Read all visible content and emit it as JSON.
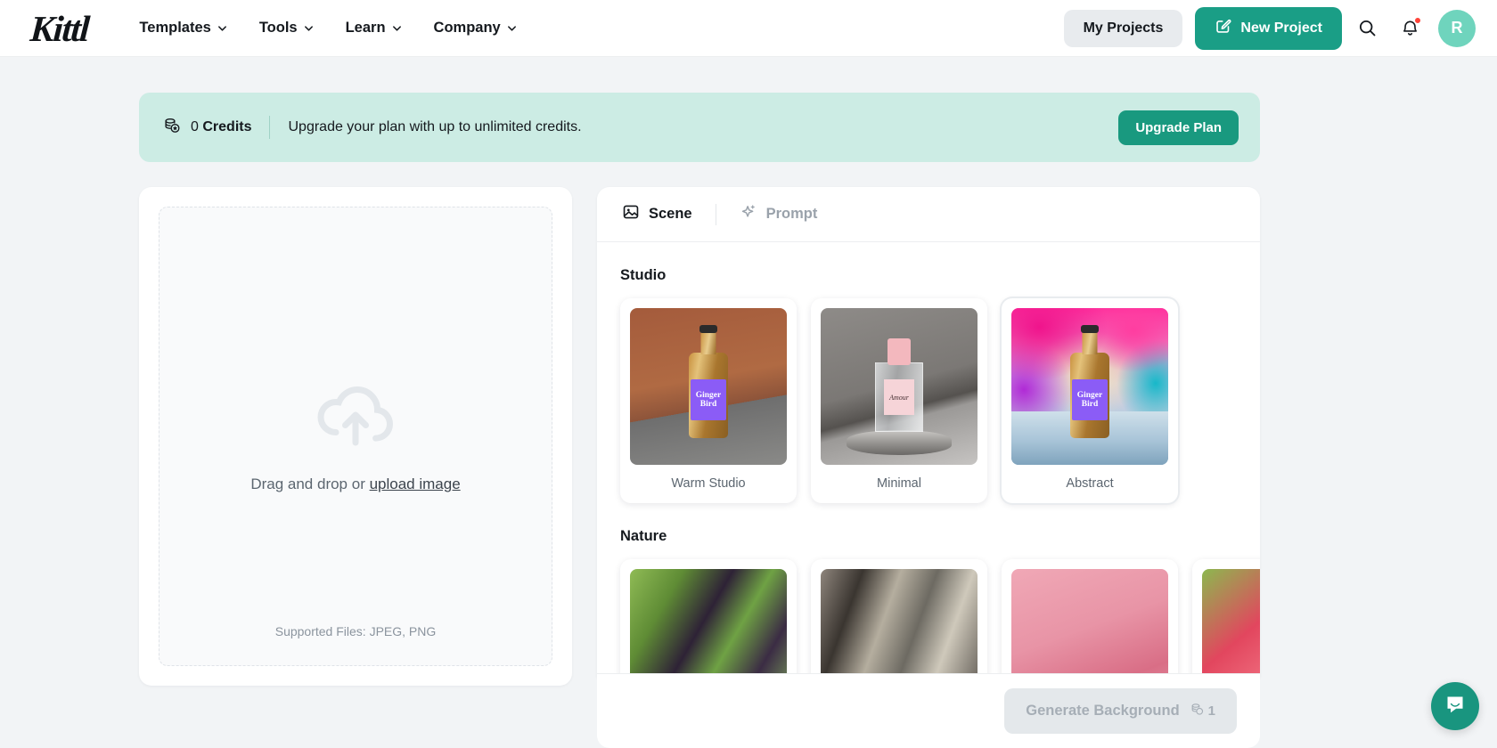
{
  "header": {
    "logo": "Kittl",
    "nav": [
      {
        "label": "Templates",
        "icon": "chevron-down-icon"
      },
      {
        "label": "Tools",
        "icon": "chevron-down-icon"
      },
      {
        "label": "Learn",
        "icon": "chevron-down-icon"
      },
      {
        "label": "Company",
        "icon": "chevron-down-icon"
      }
    ],
    "my_projects_label": "My Projects",
    "new_project_label": "New Project",
    "new_project_icon": "edit-square-icon",
    "search_icon": "search-icon",
    "notifications_icon": "bell-icon",
    "avatar_initial": "R",
    "accent_color": "#1a9e86",
    "avatar_color": "#6fd4bd",
    "notification_dot_color": "#ff4338"
  },
  "banner": {
    "icon": "coins-star-icon",
    "credits_count": "0",
    "credits_word": "Credits",
    "message": "Upgrade your plan with up to unlimited credits.",
    "upgrade_label": "Upgrade Plan",
    "background_color": "#ccece4",
    "button_color": "#19997f"
  },
  "upload": {
    "icon": "cloud-upload-icon",
    "drag_text": "Drag and drop or ",
    "link_text": "upload image",
    "supported_text": "Supported Files: JPEG, PNG"
  },
  "scene_panel": {
    "tabs": [
      {
        "label": "Scene",
        "icon": "image-icon",
        "active": true
      },
      {
        "label": "Prompt",
        "icon": "sparkle-icon",
        "active": false
      }
    ],
    "sections": [
      {
        "title": "Studio",
        "cards": [
          {
            "label": "Warm Studio",
            "art": "art-warm",
            "subject": "bottle",
            "selected": false
          },
          {
            "label": "Minimal",
            "art": "art-min",
            "subject": "perfume",
            "selected": false
          },
          {
            "label": "Abstract",
            "art": "art-abs",
            "subject": "bottle",
            "selected": true
          }
        ]
      },
      {
        "title": "Nature",
        "cards": [
          {
            "label": "",
            "art": "art-n1",
            "subject": "none",
            "selected": false
          },
          {
            "label": "",
            "art": "art-n2",
            "subject": "none",
            "selected": false
          },
          {
            "label": "",
            "art": "art-n3",
            "subject": "none",
            "selected": false
          },
          {
            "label": "",
            "art": "art-n4",
            "subject": "none",
            "selected": false
          }
        ]
      }
    ],
    "bottle_label_line1": "Ginger",
    "bottle_label_line2": "Bird",
    "perfume_label": "Amour"
  },
  "action_bar": {
    "generate_label": "Generate Background",
    "credit_cost": "1",
    "credit_icon": "coins-icon",
    "disabled": true
  },
  "chat": {
    "icon": "chat-bubble-icon",
    "color": "#19957f"
  }
}
